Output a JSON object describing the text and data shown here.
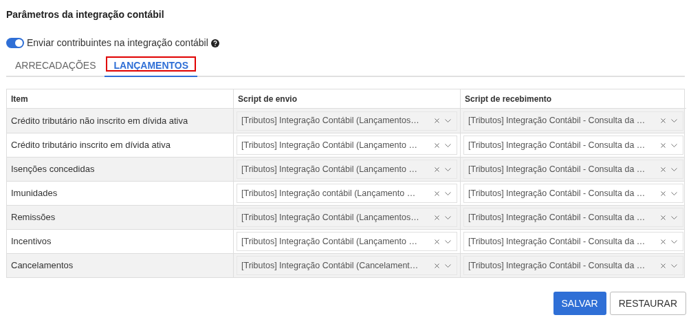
{
  "title": "Parâmetros da integração contábil",
  "toggle": {
    "label": "Enviar contribuintes na integração contábil",
    "on": true
  },
  "tabs": [
    {
      "label": "ARRECADAÇÕES",
      "selected": false,
      "highlighted": false
    },
    {
      "label": "LANÇAMENTOS",
      "selected": true,
      "highlighted": true
    }
  ],
  "table": {
    "columns": [
      "Item",
      "Script de envio",
      "Script de recebimento"
    ],
    "rows": [
      {
        "item": "Crédito tributário não inscrito em dívida ativa",
        "send": "[Tributos] Integração Contábil (Lançamentos…",
        "receive": "[Tributos] Integração Contábil - Consulta da …"
      },
      {
        "item": "Crédito tributário inscrito em dívida ativa",
        "send": "[Tributos] Integração Contábil (Lançamento …",
        "receive": "[Tributos] Integração Contábil - Consulta da …"
      },
      {
        "item": "Isenções concedidas",
        "send": "[Tributos] Integração Contábil (Lançamento …",
        "receive": "[Tributos] Integração Contábil - Consulta da …"
      },
      {
        "item": "Imunidades",
        "send": "[Tributos] Integração contábil (Lançamento …",
        "receive": "[Tributos] Integração Contábil - Consulta da …"
      },
      {
        "item": "Remissões",
        "send": "[Tributos] Integração Contábil (Lançamentos…",
        "receive": "[Tributos] Integração Contábil - Consulta da …"
      },
      {
        "item": "Incentivos",
        "send": "[Tributos] Integração Contábil (Lançamento …",
        "receive": "[Tributos] Integração Contábil - Consulta da …"
      },
      {
        "item": "Cancelamentos",
        "send": "[Tributos] Integração Contábil (Cancelament…",
        "receive": "[Tributos] Integração Contábil - Consulta da …"
      }
    ]
  },
  "buttons": [
    {
      "label": "SALVAR",
      "kind": "primary"
    },
    {
      "label": "RESTAURAR",
      "kind": "secondary"
    }
  ]
}
